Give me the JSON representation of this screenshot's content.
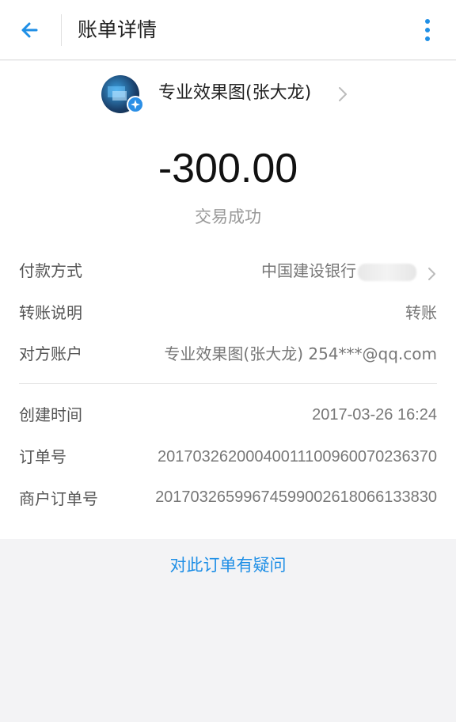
{
  "header": {
    "title": "账单详情",
    "back_icon": "arrow-left-icon",
    "more_icon": "more-vertical-icon",
    "accent": "#1f8fe6"
  },
  "payee": {
    "name": "专业效果图(张大龙)",
    "avatar_icon": "avatar",
    "badge_icon": "verified-badge-icon"
  },
  "amount": "-300.00",
  "status": "交易成功",
  "details": {
    "payment_method": {
      "label": "付款方式",
      "value": "中国建设银行"
    },
    "transfer_note": {
      "label": "转账说明",
      "value": "转账"
    },
    "counterparty": {
      "label": "对方账户",
      "value": "专业效果图(张大龙) 254***@qq.com"
    }
  },
  "order_info": {
    "created_time": {
      "label": "创建时间",
      "value": "2017-03-26 16:24"
    },
    "order_no": {
      "label": "订单号",
      "value": "20170326200040011100960070236370"
    },
    "merchant_order_no": {
      "label": "商户订单号",
      "value": "20170326599674599002618066133830"
    }
  },
  "query_link": "对此订单有疑问"
}
